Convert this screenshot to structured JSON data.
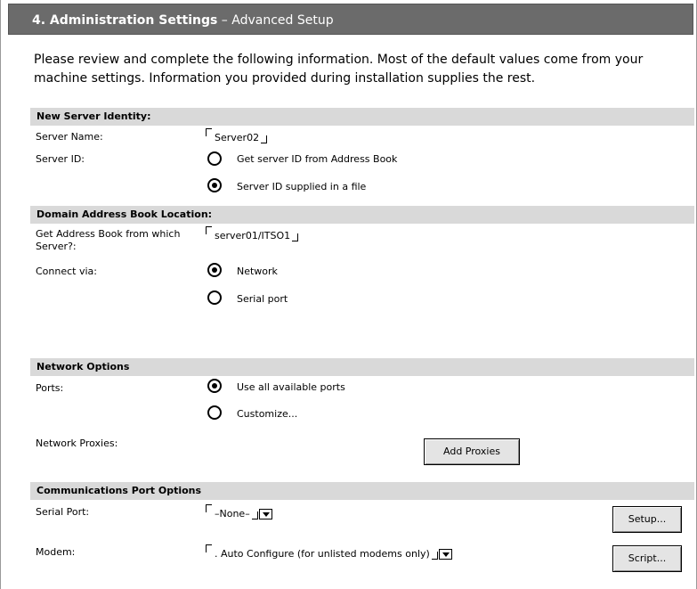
{
  "header": {
    "step_title": "4. Administration Settings",
    "subtitle": " – Advanced Setup"
  },
  "intro": "Please review and complete the following information. Most of the default values come from your machine settings. Information you provided during installation supplies the rest.",
  "identity": {
    "section_title": "New Server Identity:",
    "server_name_label": "Server Name:",
    "server_name_value": "Server02",
    "server_id_label": "Server ID:",
    "server_id_options": [
      "Get server ID from Address Book",
      "Server ID supplied in a file"
    ],
    "server_id_selected": 1
  },
  "domain": {
    "section_title": "Domain Address Book Location:",
    "from_label": "Get Address Book from which Server?:",
    "from_value": "server01/ITSO1",
    "connect_label": "Connect via:",
    "connect_options": [
      "Network",
      "Serial port"
    ],
    "connect_selected": 0
  },
  "network": {
    "section_title": "Network Options",
    "ports_label": "Ports:",
    "ports_options": [
      "Use all available ports",
      "Customize..."
    ],
    "ports_selected": 0,
    "proxies_label": "Network Proxies:",
    "add_proxies_button": "Add Proxies"
  },
  "comm": {
    "section_title": "Communications Port Options",
    "serial_label": "Serial Port:",
    "serial_value": "–None–",
    "setup_button": "Setup...",
    "modem_label": "Modem:",
    "modem_value": ". Auto Configure (for unlisted modems only)",
    "script_button": "Script..."
  },
  "icons": {
    "radio_selected": "radio-selected-icon",
    "radio_unselected": "radio-unselected-icon",
    "dropdown": "chevron-down-icon",
    "field_bracket": "field-bracket-icon"
  }
}
